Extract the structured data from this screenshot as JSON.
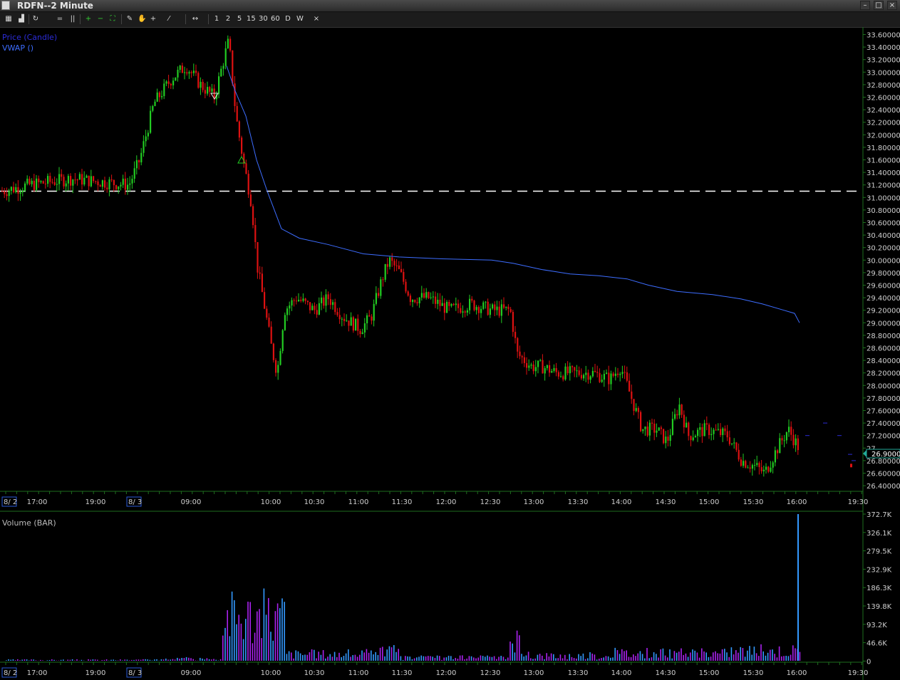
{
  "window": {
    "title": "RDFN--2 Minute"
  },
  "toolbar": {
    "intervals": [
      "1",
      "2",
      "5",
      "15",
      "30",
      "60",
      "D",
      "W"
    ],
    "close_label": "×"
  },
  "price_panel": {
    "legend": [
      "Price (Candle)",
      "VWAP ()"
    ],
    "legend_colors": [
      "#2c2cd9",
      "#3d6dff"
    ],
    "axis_ticks": [
      "33.60000",
      "33.40000",
      "33.20000",
      "33.00000",
      "32.80000",
      "32.60000",
      "32.40000",
      "32.20000",
      "32.00000",
      "31.80000",
      "31.60000",
      "31.40000",
      "31.20000",
      "31.00000",
      "30.80000",
      "30.60000",
      "30.40000",
      "30.20000",
      "30.00000",
      "29.80000",
      "29.60000",
      "29.40000",
      "29.20000",
      "29.00000",
      "28.80000",
      "28.60000",
      "28.40000",
      "28.20000",
      "28.00000",
      "27.80000",
      "27.60000",
      "27.40000",
      "27.20000",
      "27",
      "26.80000",
      "26.60000",
      "26.40000"
    ],
    "last_price": "26.9000",
    "reference_line": 31.1
  },
  "time_axis": {
    "date_markers": [
      "8/ 2",
      "8/ 3"
    ],
    "labels": [
      "17:00",
      "19:00",
      "09:00",
      "10:00",
      "10:30",
      "11:00",
      "11:30",
      "12:00",
      "12:30",
      "13:00",
      "13:30",
      "14:00",
      "14:30",
      "15:00",
      "15:30",
      "16:00",
      "19:30"
    ]
  },
  "volume_panel": {
    "title": "Volume (BAR)",
    "axis_ticks": [
      "372.7K",
      "326.1K",
      "279.5K",
      "232.9K",
      "186.3K",
      "139.8K",
      "93.2K",
      "46.6K",
      "0"
    ]
  },
  "colors": {
    "up": "#22cc22",
    "down": "#dd1111",
    "vwap": "#3d6dff",
    "vol_up": "#3399ff",
    "vol_down": "#aa22ee",
    "grid_axis": "#1e6e1e"
  },
  "chart_data": [
    {
      "type": "candlestick",
      "title": "RDFN--2 Minute",
      "series": [
        {
          "name": "Price (Candle)",
          "values": [
            31.1,
            31.2,
            31.3,
            31.6,
            32.5,
            33.1,
            32.7,
            33.5,
            32.2,
            31.6,
            30.1,
            29.5,
            28.2,
            29.2,
            29.0,
            29.4,
            28.8,
            29.1,
            30.0,
            29.7,
            29.5,
            29.3,
            29.5,
            29.1,
            28.6,
            28.3,
            28.4,
            28.1,
            28.4,
            27.6,
            27.3,
            27.7,
            27.3,
            27.2,
            26.7,
            27.1,
            27.3,
            26.9
          ]
        },
        {
          "name": "VWAP ()",
          "values": [
            31.6,
            31.6,
            31.6,
            31.6,
            31.9,
            32.4,
            32.8,
            33.0,
            32.4,
            31.5,
            30.6,
            30.4,
            30.2,
            30.1,
            30.05,
            30.0,
            29.8,
            29.7,
            29.5,
            29.4,
            29.2,
            29.0
          ]
        }
      ],
      "ylim": [
        26.3,
        33.7
      ]
    },
    {
      "type": "bar",
      "title": "Volume (BAR)",
      "ylim": [
        0,
        372.7
      ],
      "values_k": [
        2,
        3,
        5,
        8,
        12,
        190,
        150,
        170,
        110,
        60,
        40,
        30,
        20,
        60,
        15,
        12,
        8,
        90,
        12,
        8,
        6,
        40,
        20,
        30,
        15,
        50,
        40,
        372.7
      ]
    }
  ]
}
